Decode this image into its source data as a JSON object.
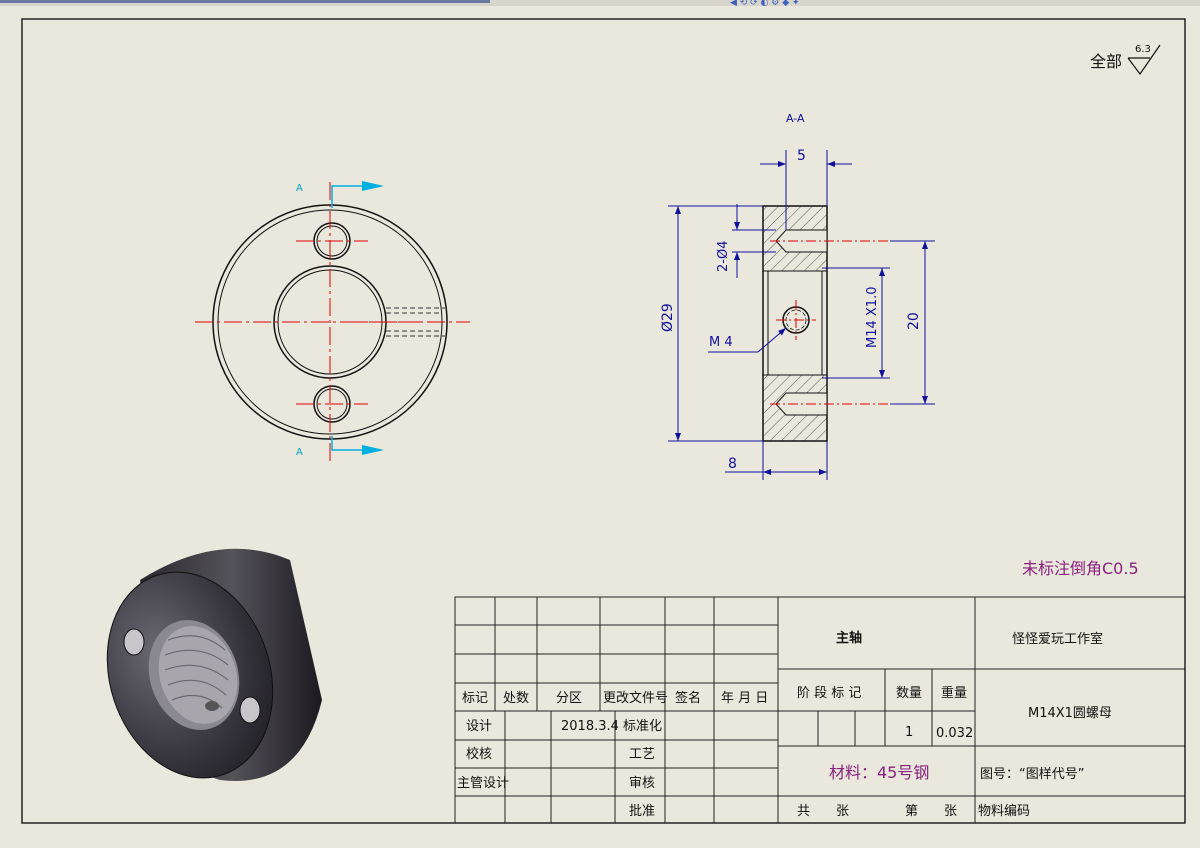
{
  "roughness": {
    "label": "全部",
    "value": "6.3"
  },
  "section": {
    "title": "A-A",
    "marker_top": "A",
    "marker_bottom": "A"
  },
  "dimensions": {
    "width_top": "5",
    "hole_spec": "2-Ø4",
    "outer_diameter": "Ø29",
    "tapped_hole": "M 4",
    "thread": "M14 X1.0",
    "bolt_spacing": "20",
    "width_bottom": "8"
  },
  "notes": {
    "chamfer": "未标注倒角C0.5"
  },
  "title_block": {
    "part_name": "主轴",
    "company": "怪怪爱玩工作室",
    "drawing_name": "M14X1圆螺母",
    "material": "材料：45号钢",
    "drawing_number": "图号：“图样代号”",
    "headers": {
      "mark": "标记",
      "count": "处数",
      "zone": "分区",
      "change_doc": "更改文件号",
      "signature": "签名",
      "date": "年 月 日"
    },
    "rows": {
      "design": "设计",
      "design_date": "2018.3.4",
      "standardize": "标准化",
      "check": "校核",
      "process": "工艺",
      "chief_design": "主管设计",
      "review": "审核",
      "approve": "批准"
    },
    "stage_label": "阶 段 标 记",
    "quantity_label": "数量",
    "weight_label": "重量",
    "quantity": "1",
    "weight": "0.032",
    "total_sheets": "共　　张",
    "sheet_no": "第　　张",
    "material_code": "物料编码"
  },
  "colors": {
    "dimension": "#1010a0",
    "centerline": "#e00000",
    "arrow": "#00b0e0",
    "note": "#8a2080"
  }
}
